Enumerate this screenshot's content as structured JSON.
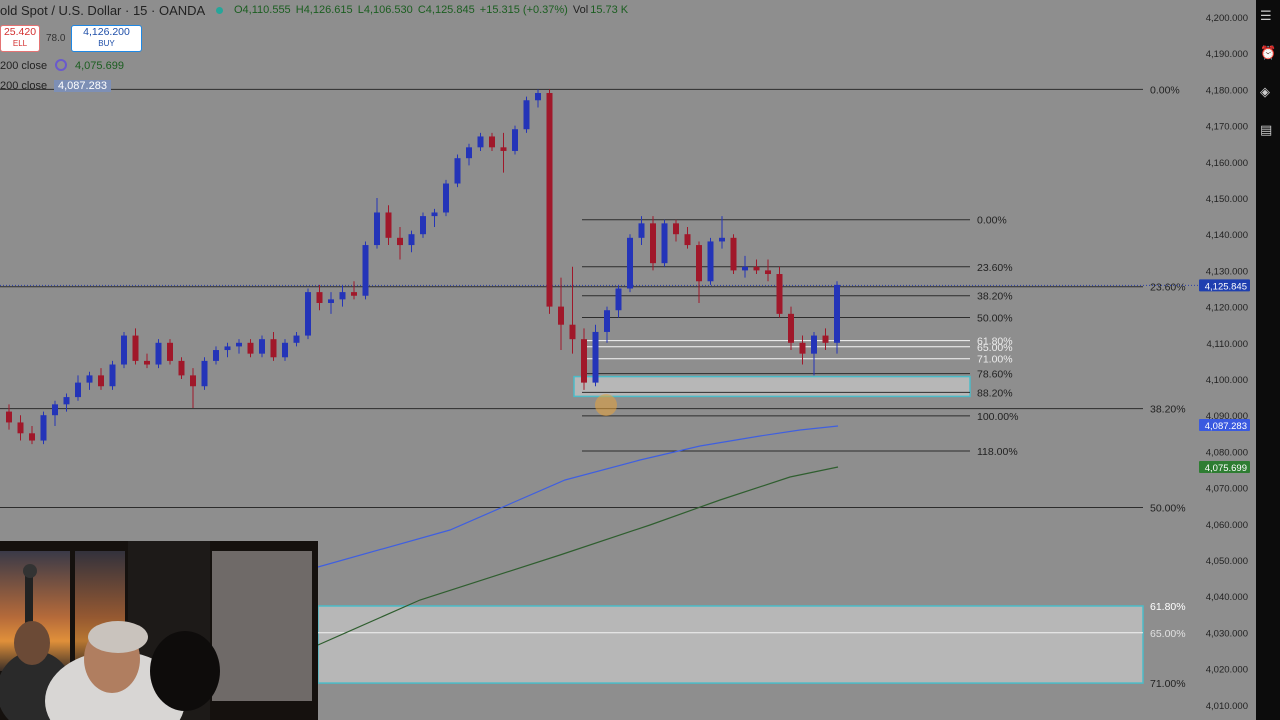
{
  "header": {
    "symbol": "old Spot / U.S. Dollar · 15 · OANDA",
    "open": "O4,110.555",
    "high": "H4,126.615",
    "low": "L4,106.530",
    "close": "C4,125.845",
    "change": "+15.315 (+0.37%)",
    "volume_label": "Vol",
    "volume_value": "15.73 K"
  },
  "trade": {
    "sell_price": "25.420",
    "sell_label": "ELL",
    "spread": "78.0",
    "buy_price": "4,126.200",
    "buy_label": "BUY"
  },
  "indicators": {
    "ma1_label": "200 close",
    "ma1_value": "4,075.699",
    "ma2_label": "200 close",
    "ma2_value": "4,087.283"
  },
  "colors": {
    "background": "#8e8e8e",
    "bull": "#2434b8",
    "bear": "#a0182a",
    "ma_blue": "#3f5fe0",
    "ma_green": "#2f5e2f",
    "fib_box": "#4bbcc8",
    "price_tag": "#1e3fb0"
  },
  "right_toolbar_icons": [
    "list-icon",
    "alarm-icon",
    "layers-icon",
    "notes-icon"
  ],
  "chart_data": {
    "type": "candlestick",
    "y_axis_ticks": [
      "4,200.000",
      "4,190.000",
      "4,180.000",
      "4,170.000",
      "4,160.000",
      "4,150.000",
      "4,140.000",
      "4,130.000",
      "4,120.000",
      "4,110.000",
      "4,100.000",
      "4,090.000",
      "4,080.000",
      "4,070.000",
      "4,060.000",
      "4,050.000",
      "4,040.000",
      "4,030.000",
      "4,020.000",
      "4,010.000"
    ],
    "y_range": [
      4008,
      4205
    ],
    "last_price": "4,125.845",
    "ma_blue_price": "4,087.283",
    "ma_green_price": "4,075.699",
    "candles": [
      {
        "o": 4091,
        "h": 4093,
        "l": 4086,
        "c": 4088
      },
      {
        "o": 4088,
        "h": 4090,
        "l": 4083,
        "c": 4085
      },
      {
        "o": 4085,
        "h": 4087,
        "l": 4082,
        "c": 4083
      },
      {
        "o": 4083,
        "h": 4091,
        "l": 4082,
        "c": 4090
      },
      {
        "o": 4090,
        "h": 4094,
        "l": 4087,
        "c": 4093
      },
      {
        "o": 4093,
        "h": 4096,
        "l": 4091,
        "c": 4095
      },
      {
        "o": 4095,
        "h": 4101,
        "l": 4094,
        "c": 4099
      },
      {
        "o": 4099,
        "h": 4102,
        "l": 4097,
        "c": 4101
      },
      {
        "o": 4101,
        "h": 4103,
        "l": 4097,
        "c": 4098
      },
      {
        "o": 4098,
        "h": 4105,
        "l": 4097,
        "c": 4104
      },
      {
        "o": 4104,
        "h": 4113,
        "l": 4103,
        "c": 4112
      },
      {
        "o": 4112,
        "h": 4114,
        "l": 4104,
        "c": 4105
      },
      {
        "o": 4105,
        "h": 4107,
        "l": 4103,
        "c": 4104
      },
      {
        "o": 4104,
        "h": 4111,
        "l": 4103,
        "c": 4110
      },
      {
        "o": 4110,
        "h": 4111,
        "l": 4104,
        "c": 4105
      },
      {
        "o": 4105,
        "h": 4106,
        "l": 4100,
        "c": 4101
      },
      {
        "o": 4101,
        "h": 4103,
        "l": 4092,
        "c": 4098
      },
      {
        "o": 4098,
        "h": 4106,
        "l": 4097,
        "c": 4105
      },
      {
        "o": 4105,
        "h": 4109,
        "l": 4104,
        "c": 4108
      },
      {
        "o": 4108,
        "h": 4110,
        "l": 4106,
        "c": 4109
      },
      {
        "o": 4109,
        "h": 4111,
        "l": 4107,
        "c": 4110
      },
      {
        "o": 4110,
        "h": 4111,
        "l": 4106,
        "c": 4107
      },
      {
        "o": 4107,
        "h": 4112,
        "l": 4106,
        "c": 4111
      },
      {
        "o": 4111,
        "h": 4113,
        "l": 4105,
        "c": 4106
      },
      {
        "o": 4106,
        "h": 4111,
        "l": 4105,
        "c": 4110
      },
      {
        "o": 4110,
        "h": 4113,
        "l": 4109,
        "c": 4112
      },
      {
        "o": 4112,
        "h": 4125,
        "l": 4111,
        "c": 4124
      },
      {
        "o": 4124,
        "h": 4126,
        "l": 4119,
        "c": 4121
      },
      {
        "o": 4121,
        "h": 4124,
        "l": 4118,
        "c": 4122
      },
      {
        "o": 4122,
        "h": 4126,
        "l": 4120,
        "c": 4124
      },
      {
        "o": 4124,
        "h": 4127,
        "l": 4122,
        "c": 4123
      },
      {
        "o": 4123,
        "h": 4138,
        "l": 4122,
        "c": 4137
      },
      {
        "o": 4137,
        "h": 4150,
        "l": 4136,
        "c": 4146
      },
      {
        "o": 4146,
        "h": 4148,
        "l": 4137,
        "c": 4139
      },
      {
        "o": 4139,
        "h": 4142,
        "l": 4133,
        "c": 4137
      },
      {
        "o": 4137,
        "h": 4141,
        "l": 4135,
        "c": 4140
      },
      {
        "o": 4140,
        "h": 4146,
        "l": 4139,
        "c": 4145
      },
      {
        "o": 4145,
        "h": 4147,
        "l": 4142,
        "c": 4146
      },
      {
        "o": 4146,
        "h": 4155,
        "l": 4145,
        "c": 4154
      },
      {
        "o": 4154,
        "h": 4162,
        "l": 4153,
        "c": 4161
      },
      {
        "o": 4161,
        "h": 4165,
        "l": 4159,
        "c": 4164
      },
      {
        "o": 4164,
        "h": 4168,
        "l": 4163,
        "c": 4167
      },
      {
        "o": 4167,
        "h": 4168,
        "l": 4163,
        "c": 4164
      },
      {
        "o": 4164,
        "h": 4168,
        "l": 4157,
        "c": 4163
      },
      {
        "o": 4163,
        "h": 4170,
        "l": 4162,
        "c": 4169
      },
      {
        "o": 4169,
        "h": 4178,
        "l": 4168,
        "c": 4177
      },
      {
        "o": 4177,
        "h": 4180,
        "l": 4175,
        "c": 4179
      },
      {
        "o": 4179,
        "h": 4180,
        "l": 4118,
        "c": 4120
      },
      {
        "o": 4120,
        "h": 4128,
        "l": 4108,
        "c": 4115
      },
      {
        "o": 4115,
        "h": 4131,
        "l": 4107,
        "c": 4111
      },
      {
        "o": 4111,
        "h": 4114,
        "l": 4097,
        "c": 4099
      },
      {
        "o": 4099,
        "h": 4115,
        "l": 4098,
        "c": 4113
      },
      {
        "o": 4113,
        "h": 4120,
        "l": 4110,
        "c": 4119
      },
      {
        "o": 4119,
        "h": 4126,
        "l": 4117,
        "c": 4125
      },
      {
        "o": 4125,
        "h": 4140,
        "l": 4124,
        "c": 4139
      },
      {
        "o": 4139,
        "h": 4145,
        "l": 4137,
        "c": 4143
      },
      {
        "o": 4143,
        "h": 4145,
        "l": 4130,
        "c": 4132
      },
      {
        "o": 4132,
        "h": 4144,
        "l": 4131,
        "c": 4143
      },
      {
        "o": 4143,
        "h": 4144,
        "l": 4138,
        "c": 4140
      },
      {
        "o": 4140,
        "h": 4142,
        "l": 4136,
        "c": 4137
      },
      {
        "o": 4137,
        "h": 4138,
        "l": 4121,
        "c": 4127
      },
      {
        "o": 4127,
        "h": 4139,
        "l": 4126,
        "c": 4138
      },
      {
        "o": 4138,
        "h": 4145,
        "l": 4136,
        "c": 4139
      },
      {
        "o": 4139,
        "h": 4140,
        "l": 4129,
        "c": 4130
      },
      {
        "o": 4130,
        "h": 4134,
        "l": 4128,
        "c": 4131
      },
      {
        "o": 4131,
        "h": 4133,
        "l": 4129,
        "c": 4130
      },
      {
        "o": 4130,
        "h": 4133,
        "l": 4127,
        "c": 4129
      },
      {
        "o": 4129,
        "h": 4131,
        "l": 4117,
        "c": 4118
      },
      {
        "o": 4118,
        "h": 4120,
        "l": 4108,
        "c": 4110
      },
      {
        "o": 4110,
        "h": 4112,
        "l": 4104,
        "c": 4107
      },
      {
        "o": 4107,
        "h": 4113,
        "l": 4101,
        "c": 4112
      },
      {
        "o": 4112,
        "h": 4114,
        "l": 4108,
        "c": 4110
      },
      {
        "o": 4110,
        "h": 4127,
        "l": 4107,
        "c": 4126
      }
    ],
    "fib_left_labels": [
      "0.00%",
      "23.60%",
      "38.20%",
      "50.00%",
      "61.80%",
      "65.00%",
      "71.00%",
      "78.60%",
      "88.20%",
      "100.00%",
      "118.00%"
    ],
    "fib_left_prices": [
      4144,
      4131,
      4123,
      4117,
      4110.6,
      4108.9,
      4105.6,
      4101.5,
      4096.3,
      4089.8,
      4080.1
    ],
    "fib_right_labels": [
      "0.00%",
      "23.60%",
      "38.20%",
      "50.00%",
      "61.80%",
      "65.00%",
      "71.00%"
    ],
    "fib_right_prices": [
      4180,
      4125.5,
      4091.8,
      4064.5,
      4037.3,
      4029.9,
      4016
    ]
  }
}
